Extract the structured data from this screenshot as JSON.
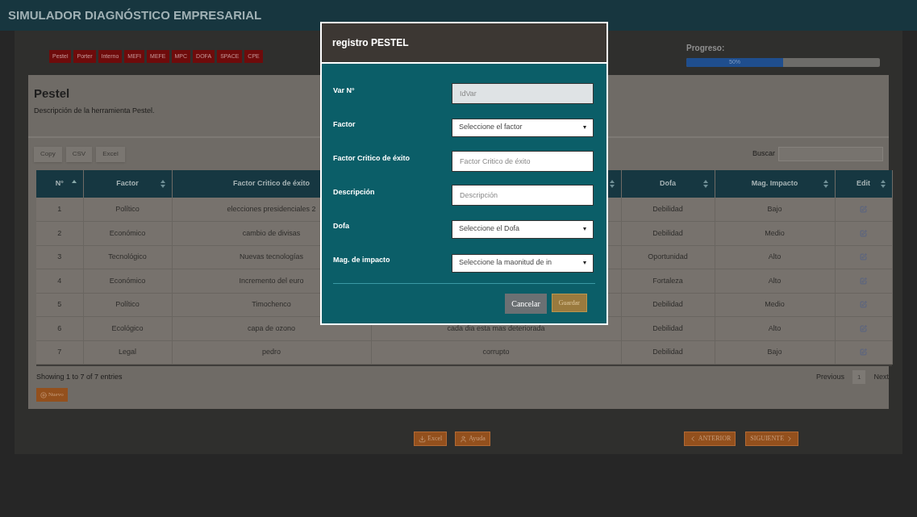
{
  "app_title": "SIMULADOR DIAGNÓSTICO EMPRESARIAL",
  "tabs": [
    "Pestel",
    "Porter",
    "Interno",
    "MEFI",
    "MEFE",
    "MPC",
    "DOFA",
    "SPACE",
    "CPE"
  ],
  "progress": {
    "label": "Progreso:",
    "text": "50%",
    "level": 0.5
  },
  "section": {
    "title": "Pestel",
    "description": "Descripción de la herramienta Pestel."
  },
  "export_buttons": [
    "Copy",
    "CSV",
    "Excel"
  ],
  "search": {
    "label": "Buscar"
  },
  "table": {
    "columns": [
      {
        "label": "N°",
        "sorted": true
      },
      {
        "label": "Factor",
        "sorted": false
      },
      {
        "label": "Factor Critico de éxito"
      },
      {
        "sorted": false
      },
      {
        "label": "Dofa",
        "sorted": false
      },
      {
        "label": "Mag. Impacto",
        "sorted": false
      },
      {
        "label": "Edit",
        "sorted": false
      }
    ],
    "rows": [
      {
        "n": "1",
        "factor": "Político",
        "critical": "elecciones presidenciales 2",
        "dofa": "Debilidad",
        "impact": "Bajo"
      },
      {
        "n": "2",
        "factor": "Económico",
        "critical": "cambio de divisas",
        "dofa": "Debilidad",
        "impact": "Medio"
      },
      {
        "n": "3",
        "factor": "Tecnológico",
        "critical": "Nuevas tecnologías",
        "dofa": "Oportunidad",
        "impact": "Alto"
      },
      {
        "n": "4",
        "factor": "Económico",
        "critical": "Incremento del euro",
        "dofa": "Fortaleza",
        "impact": "Alto"
      },
      {
        "n": "5",
        "factor": "Político",
        "critical": "Timochenco",
        "dofa": "Debilidad",
        "impact": "Medio"
      },
      {
        "n": "6",
        "factor": "Ecológico",
        "critical": "capa de ozono",
        "description": "cada dia esta mas deteriorada",
        "dofa": "Debilidad",
        "impact": "Alto"
      },
      {
        "n": "7",
        "factor": "Legal",
        "critical": "pedro",
        "description": "corrupto",
        "dofa": "Debilidad",
        "impact": "Bajo"
      }
    ]
  },
  "table_info": "Showing 1 to 7 of 7 entries",
  "pagination": {
    "previous": "Previous",
    "page": "1",
    "next": "Next"
  },
  "new_button": "Nuevo",
  "footer_buttons": [
    {
      "kind": "excel",
      "label": "Excel"
    },
    {
      "kind": "help",
      "label": "Ayuda"
    },
    {
      "kind": "prev",
      "label": "ANTERIOR"
    },
    {
      "kind": "next",
      "label": "SIGUIENTE"
    }
  ],
  "modal": {
    "title": "registro PESTEL",
    "fields": [
      {
        "label": "Var N°",
        "kind": "input",
        "placeholder": "IdVar",
        "disabled": true
      },
      {
        "label": "Factor",
        "kind": "select",
        "placeholder": "Seleccione el factor",
        "disabled": false
      },
      {
        "label": "Factor Critico de éxito",
        "kind": "input",
        "placeholder": "Factor Critico de éxito",
        "disabled": false
      },
      {
        "label": "Descripción",
        "kind": "input",
        "placeholder": "Descripción",
        "disabled": false
      },
      {
        "label": "Dofa",
        "kind": "select",
        "placeholder": "Seleccione el Dofa",
        "disabled": false
      },
      {
        "label": "Mag. de impacto",
        "kind": "select",
        "placeholder": "Seleccione la maonitud de in",
        "disabled": false
      }
    ],
    "cancel": "Cancelar",
    "save": "Guardar"
  }
}
